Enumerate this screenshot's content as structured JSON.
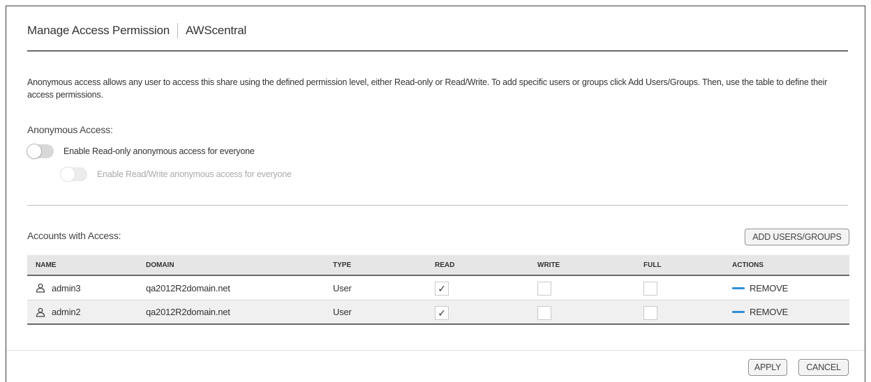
{
  "dialog": {
    "title": "Manage Access Permission",
    "subtitle": "AWScentral"
  },
  "description": "Anonymous access allows any user to access this share using the defined permission level, either Read-only or Read/Write. To add specific users or groups click Add Users/Groups. Then, use the table to define their access permissions.",
  "anonymous": {
    "title": "Anonymous Access:",
    "readonly_label": "Enable Read-only anonymous access for everyone",
    "readonly_enabled": false,
    "readwrite_label": "Enable Read/Write anonymous access for everyone",
    "readwrite_enabled": false
  },
  "accounts": {
    "title": "Accounts with Access:",
    "add_button": "ADD USERS/GROUPS",
    "columns": [
      "NAME",
      "DOMAIN",
      "TYPE",
      "READ",
      "WRITE",
      "FULL",
      "ACTIONS"
    ],
    "rows": [
      {
        "name": "admin3",
        "domain": "qa2012R2domain.net",
        "type": "User",
        "read": true,
        "write": false,
        "full": false,
        "action": "REMOVE"
      },
      {
        "name": "admin2",
        "domain": "qa2012R2domain.net",
        "type": "User",
        "read": true,
        "write": false,
        "full": false,
        "action": "REMOVE"
      }
    ]
  },
  "footer": {
    "apply": "APPLY",
    "cancel": "CANCEL"
  },
  "colors": {
    "accent": "#2f8fd8",
    "rule": "#6a6a6a",
    "header_bg": "#e6e6e6"
  },
  "icons": {
    "user": "user-icon",
    "remove": "minus-icon",
    "check": "checkmark-icon"
  }
}
